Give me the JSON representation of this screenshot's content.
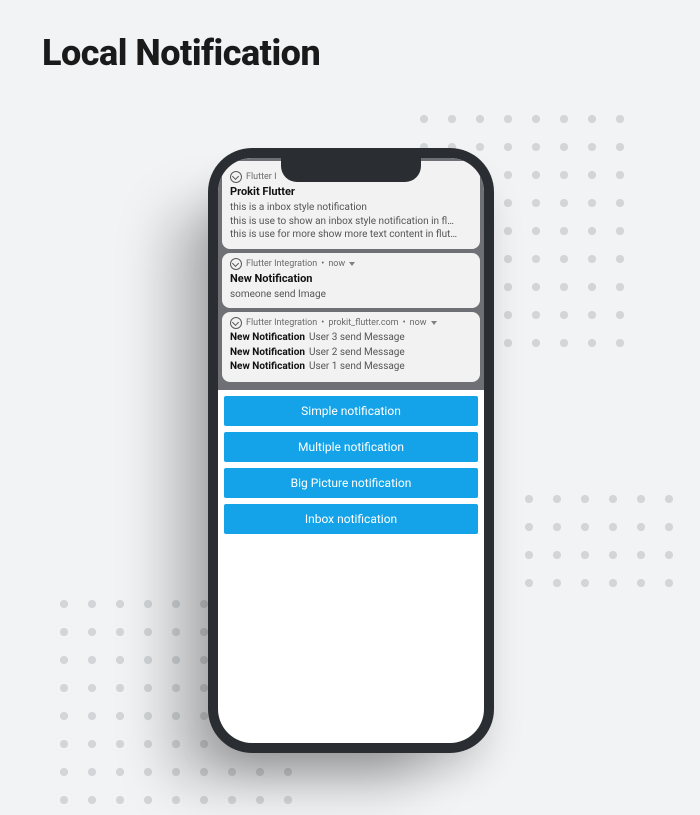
{
  "heading": "Local Notification",
  "cards": {
    "inbox": {
      "app": "Flutter I",
      "title": "Prokit Flutter",
      "lines": [
        "this is a inbox style notification",
        "this is use to show an inbox style notification in fl…",
        "this is use for more show more text content in flut…"
      ]
    },
    "single": {
      "app": "Flutter Integration",
      "time": "now",
      "title": "New Notification",
      "body": "someone send Image"
    },
    "group": {
      "app": "Flutter Integration",
      "pkg": "prokit_flutter.com",
      "time": "now",
      "items": [
        {
          "title": "New Notification",
          "msg": "User 3 send Message"
        },
        {
          "title": "New Notification",
          "msg": "User 2 send Message"
        },
        {
          "title": "New Notification",
          "msg": "User 1 send Message"
        }
      ]
    }
  },
  "buttons": [
    "Simple notification",
    "Multiple notification",
    "Big Picture notification",
    "Inbox notification"
  ]
}
